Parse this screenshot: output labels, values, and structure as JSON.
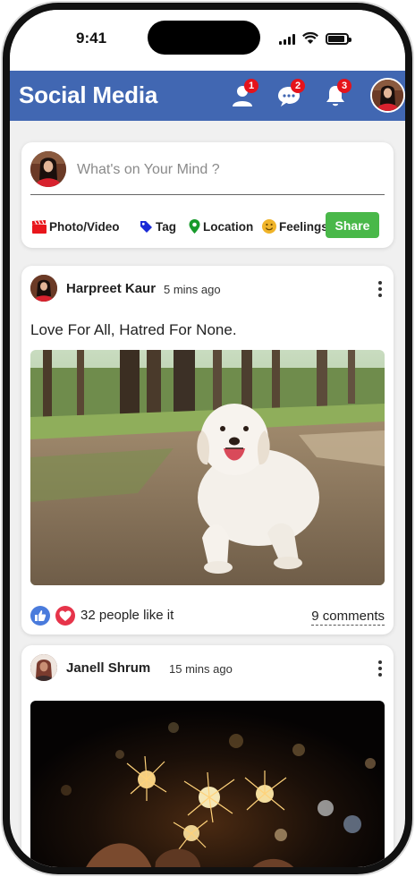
{
  "status_bar": {
    "time": "9:41"
  },
  "header": {
    "title": "Social Media",
    "friend_requests": {
      "icon": "user-icon",
      "count": "1"
    },
    "messages": {
      "icon": "chat-icon",
      "count": "2"
    },
    "notifications": {
      "icon": "bell-icon",
      "count": "3"
    },
    "accent_color": "#4167b2",
    "badge_color": "#e5131b"
  },
  "composer": {
    "placeholder": "What's on Your Mind ?",
    "actions": [
      {
        "label": "Photo/Video",
        "icon": "clapperboard-icon",
        "color": "#e8161c"
      },
      {
        "label": "Tag",
        "icon": "tag-icon",
        "color": "#1b2bd6"
      },
      {
        "label": "Location",
        "icon": "map-pin-icon",
        "color": "#179a2b"
      },
      {
        "label": "Feelings",
        "icon": "smiley-icon",
        "color": "#f0b429"
      }
    ],
    "share_label": "Share",
    "share_color": "#49b849"
  },
  "posts": [
    {
      "author": "Harpreet Kaur",
      "time": "5 mins ago",
      "text": "Love For All, Hatred For None.",
      "image": "photo of a white golden retriever lying on a sandy forest path",
      "likes_text": "32 people like it",
      "comments_text": "9 comments"
    },
    {
      "author": "Janell Shrum",
      "time": "15 mins ago",
      "image": "photo of hands holding lit sparklers at night"
    }
  ]
}
